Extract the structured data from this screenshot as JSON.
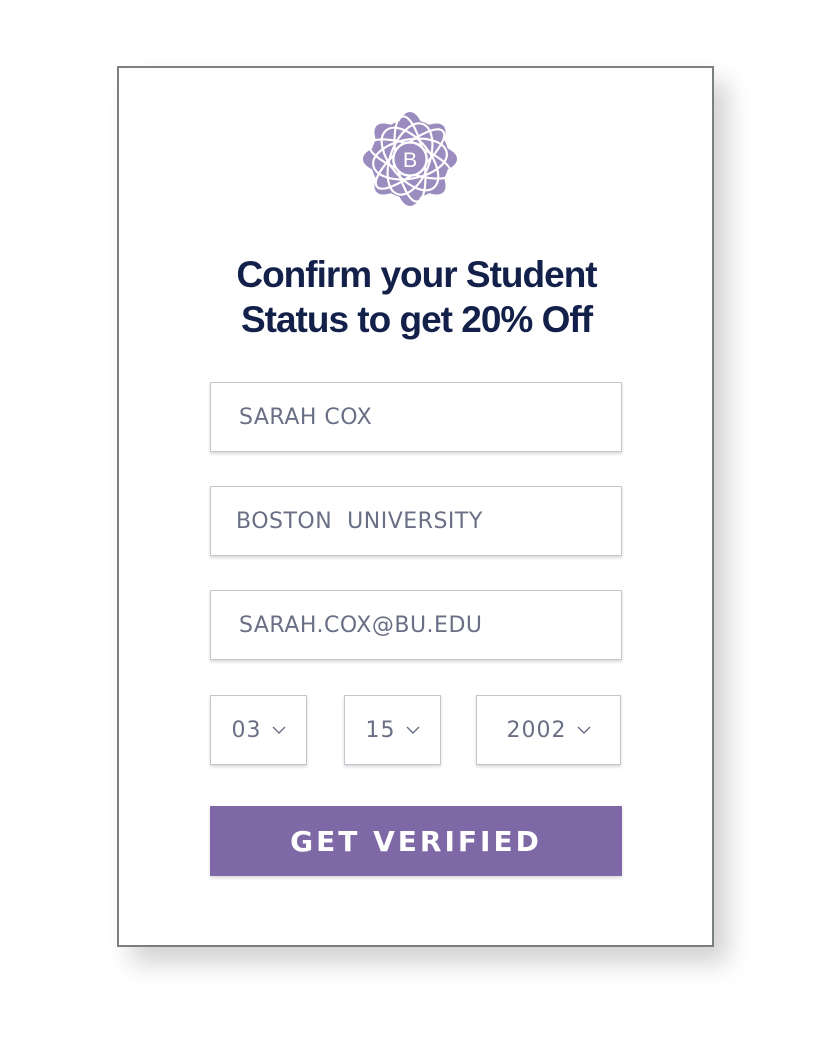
{
  "brand": {
    "logo_letter": "B",
    "logo_icon": "atom-flower-logo-icon",
    "accent_color": "#9a8cbf",
    "button_color": "#7f68a6",
    "title_color": "#12204a"
  },
  "form": {
    "title": "Confirm your Student Status to get 20% Off",
    "title_line1": "Confirm your Student",
    "title_line2": "Status to get 20% Off",
    "name_value": "SARAH COX",
    "school_value": "BOSTON  UNIVERSITY",
    "email_value": "SARAH.COX@BU.EDU",
    "birth_month": "03",
    "birth_day": "15",
    "birth_year": "2002",
    "chevron_icon": "chevron-down-icon",
    "submit_label": "GET VERIFIED"
  }
}
